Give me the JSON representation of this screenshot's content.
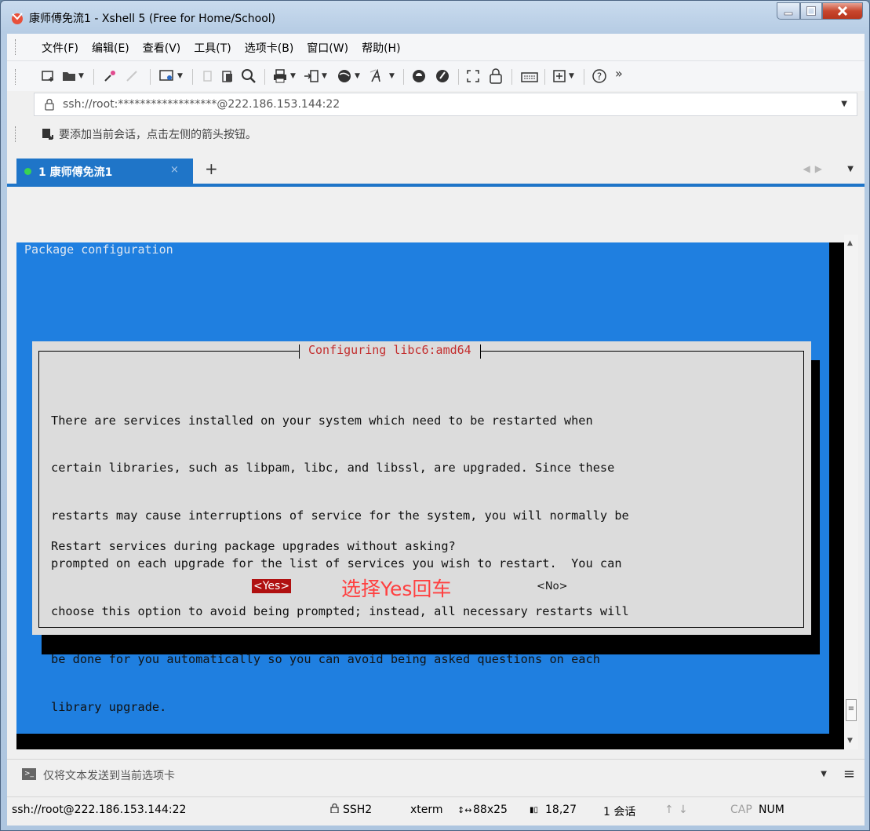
{
  "window": {
    "title": "康师傅免流1 - Xshell 5 (Free for Home/School)"
  },
  "menu": {
    "items": [
      "文件(F)",
      "编辑(E)",
      "查看(V)",
      "工具(T)",
      "选项卡(B)",
      "窗口(W)",
      "帮助(H)"
    ]
  },
  "toolbar": {
    "overflow_label": "»"
  },
  "address": {
    "value": "ssh://root:******************@222.186.153.144:22"
  },
  "session_hint": {
    "text": "要添加当前会话，点击左侧的箭头按钮。"
  },
  "tabs": {
    "active_label": "1 康师傅免流1",
    "close_glyph": "×",
    "add_glyph": "+"
  },
  "terminal": {
    "header": "Package configuration",
    "dialog": {
      "title": "Configuring libc6:amd64",
      "lines": [
        "There are services installed on your system which need to be restarted when",
        "certain libraries, such as libpam, libc, and libssl, are upgraded. Since these",
        "restarts may cause interruptions of service for the system, you will normally be",
        "prompted on each upgrade for the list of services you wish to restart.  You can",
        "choose this option to avoid being prompted; instead, all necessary restarts will",
        "be done for you automatically so you can avoid being asked questions on each",
        "library upgrade."
      ],
      "question": "Restart services during package upgrades without asking?",
      "yes_label": "<Yes>",
      "no_label": "<No>",
      "annotation": "选择Yes回车"
    }
  },
  "compose": {
    "text": "仅将文本发送到当前选项卡"
  },
  "status": {
    "connection": "ssh://root@222.186.153.144:22",
    "protocol": "SSH2",
    "terminal_type": "xterm",
    "size": "88x25",
    "cursor": "18,27",
    "sessions": "1 会话",
    "cap": "CAP",
    "num": "NUM"
  },
  "colors": {
    "terminal_blue": "#1f7fe0",
    "tab_active": "#1f75c8",
    "yes_highlight": "#b01010",
    "annotation_red": "#ff4040"
  }
}
